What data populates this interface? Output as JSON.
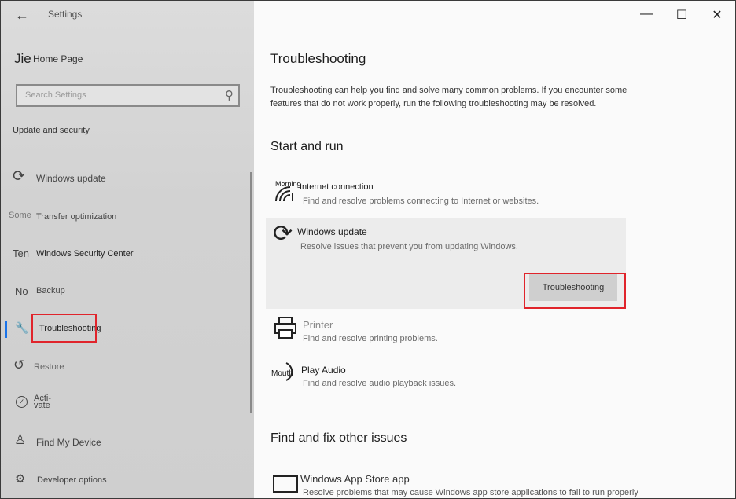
{
  "window": {
    "title": "Settings",
    "minimize": "—",
    "maximize": "☐",
    "close": "✕"
  },
  "sidebar": {
    "home_icon_glyph": "Jie",
    "home_label": "Home Page",
    "search_placeholder": "Search Settings",
    "section_title": "Update and security",
    "items": [
      {
        "icon_glyph": "⟳",
        "label": "Windows update",
        "icon": "refresh-icon"
      },
      {
        "icon_glyph": "Some",
        "label": "Transfer optimization",
        "icon": "transfer-icon"
      },
      {
        "icon_glyph": "Ten",
        "label": "Windows Security Center",
        "icon": "shield-icon"
      },
      {
        "icon_glyph": "No",
        "label": "Backup",
        "icon": "backup-icon"
      },
      {
        "icon_glyph": "🔧",
        "label": "Troubleshooting",
        "icon": "wrench-icon"
      },
      {
        "icon_glyph": "↺",
        "label": "Restore",
        "icon": "restore-icon"
      },
      {
        "icon_glyph": "✓",
        "label": "Acti-vate",
        "icon": "activate-icon"
      },
      {
        "icon_glyph": "♙",
        "label": "Find My Device",
        "icon": "person-icon"
      },
      {
        "icon_glyph": "⚙",
        "label": "Developer options",
        "icon": "developer-icon"
      }
    ],
    "active_index": 4
  },
  "main": {
    "title": "Troubleshooting",
    "description": "Troubleshooting can help you find and solve many common problems. If you encounter some features that do not work properly, run the following troubleshooting may be resolved.",
    "start_heading": "Start and run",
    "items": [
      {
        "icon_text": "Morning",
        "title": "Internet connection",
        "subtitle": "Find and resolve problems connecting to Internet or websites."
      },
      {
        "title": "Windows update",
        "subtitle": "Resolve issues that prevent you from updating Windows.",
        "button": "Troubleshooting"
      },
      {
        "title": "Printer",
        "subtitle": "Find and resolve printing problems."
      },
      {
        "icon_text": "Mouth",
        "title": "Play Audio",
        "subtitle": "Find and resolve audio playback issues."
      }
    ],
    "other_heading": "Find and fix other issues",
    "other_items": [
      {
        "title": "Windows App Store app",
        "subtitle": "Resolve problems that may cause Windows app store applications to fail to run properly"
      }
    ]
  }
}
